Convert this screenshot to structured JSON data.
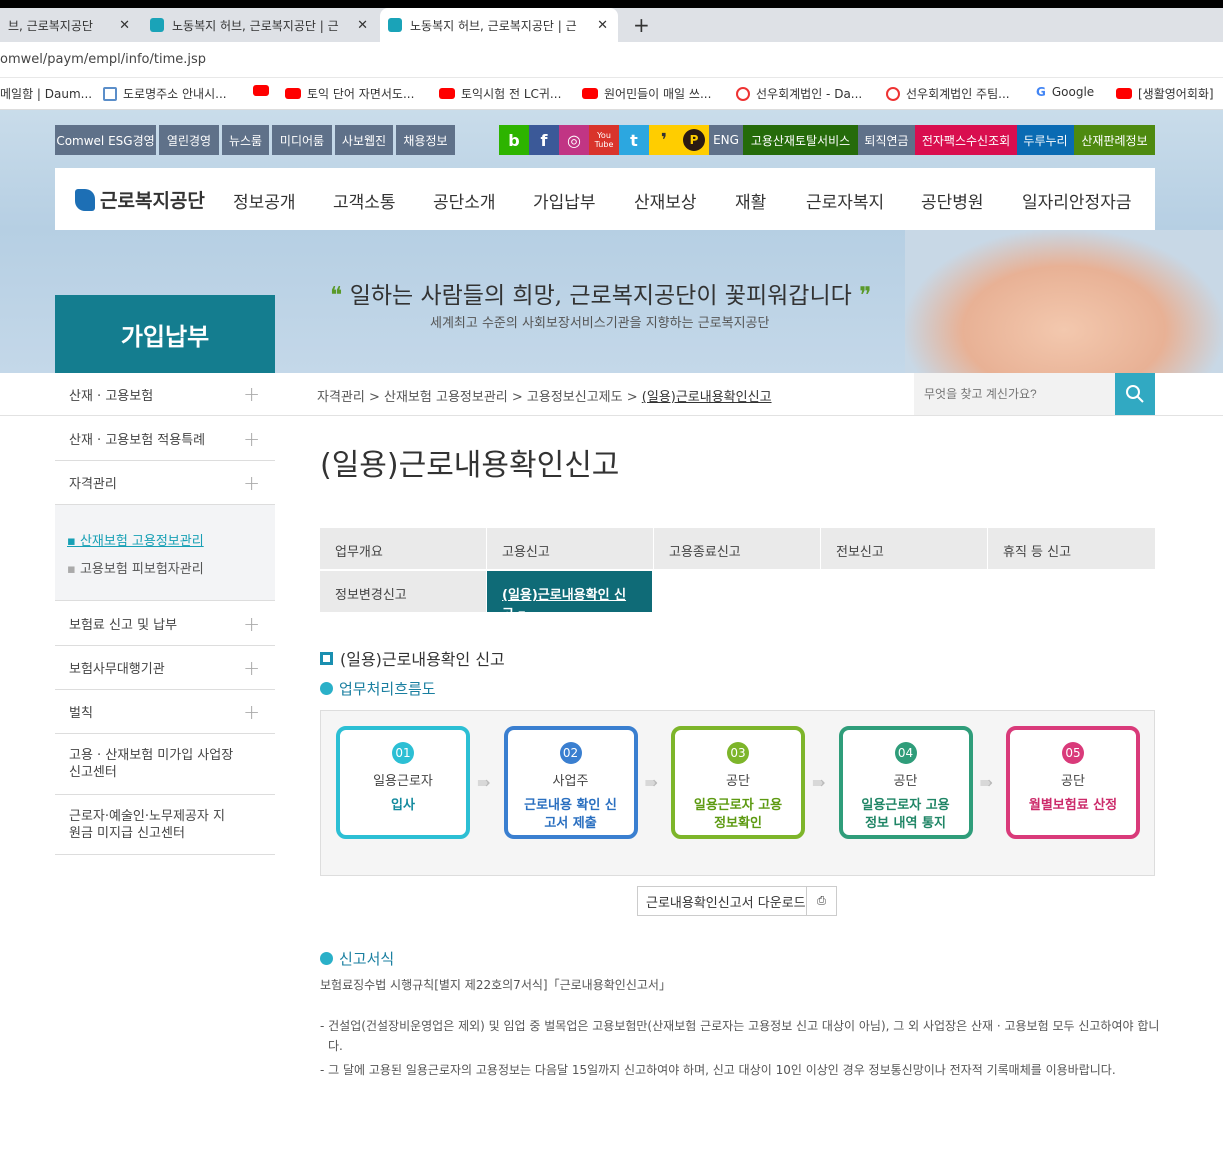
{
  "browser": {
    "tabs": [
      {
        "title": "브, 근로복지공단"
      },
      {
        "title": "노동복지 허브, 근로복지공단 | 근"
      },
      {
        "title": "노동복지 허브, 근로복지공단 | 근"
      }
    ],
    "close": "✕",
    "new_tab": "+",
    "url": "omwel/paym/empl/info/time.jsp",
    "bookmarks": [
      "메일함 | Daum...",
      "도로명주소 안내시...",
      "",
      "토익 단어 자면서도...",
      "토익시험 전 LC귀...",
      "원어민들이 매일 쓰...",
      "선우회계법인 - Da...",
      "선우회계법인 주팀...",
      "Google",
      "[생활영어회화]"
    ]
  },
  "util_left": [
    "Comwel ESG경영",
    "열린경영",
    "뉴스룸",
    "미디어룸",
    "사보웹진",
    "채용정보"
  ],
  "social": [
    "b",
    "f",
    "◎",
    "You Tube",
    "t",
    "❜",
    "P"
  ],
  "util_right": [
    "ENG",
    "고용산재토탈서비스",
    "퇴직연금",
    "전자팩스수신조회",
    "두루누리",
    "산재판례정보"
  ],
  "colors": {
    "accent": "#147d8f",
    "search": "#31a9c2"
  },
  "logo": "근로복지공단",
  "gnb": [
    "정보공개",
    "고객소통",
    "공단소개",
    "가입납부",
    "산재보상",
    "재활",
    "근로자복지",
    "공단병원",
    "일자리안정자금"
  ],
  "slogan": "일하는 사람들의 희망, 근로복지공단이 꽃피워갑니다",
  "slogan_sub": "세계최고 수준의 사회보장서비스기관을 지향하는 근로복지공단",
  "lnb_title": "가입납부",
  "side": [
    "산재 · 고용보험",
    "산재 · 고용보험 적용특례",
    "자격관리",
    "보험료 신고 및 납부",
    "보험사무대행기관",
    "벌칙",
    "고용 · 산재보험 미가입 사업장 신고센터",
    "근로자·예술인·노무제공자 지원금 미지급 신고센터"
  ],
  "side_sub": [
    "산재보험 고용정보관리",
    "고용보험 피보험자관리"
  ],
  "breadcrumb": [
    "자격관리",
    "산재보험 고용정보관리",
    "고용정보신고제도",
    "(일용)근로내용확인신고"
  ],
  "search_placeholder": "무엇을 찾고 계신가요?",
  "page_title": "(일용)근로내용확인신고",
  "subtabs": [
    "업무개요",
    "고용신고",
    "고용종료신고",
    "전보신고",
    "휴직 등 신고",
    "정보변경신고",
    "(일용)근로내용확인 신고"
  ],
  "section_title": "(일용)근로내용확인 신고",
  "flow_title": "업무처리흐름도",
  "steps": [
    {
      "num": "01",
      "who": "일용근로자",
      "act": "입사",
      "color": "#2cbfd4",
      "text": "#138a9e"
    },
    {
      "num": "02",
      "who": "사업주",
      "act": "근로내용 확인 신고서 제출",
      "color": "#3a7fd0",
      "text": "#2a6fc0"
    },
    {
      "num": "03",
      "who": "공단",
      "act": "일용근로자 고용정보확인",
      "color": "#7db52a",
      "text": "#5d9a12"
    },
    {
      "num": "04",
      "who": "공단",
      "act": "일용근로자 고용정보 내역 통지",
      "color": "#2f9d7a",
      "text": "#1f8565"
    },
    {
      "num": "05",
      "who": "공단",
      "act": "월별보험료 산정",
      "color": "#d93a7a",
      "text": "#cc2a6a"
    }
  ],
  "download": "근로내용확인신고서 다운로드",
  "form_title": "신고서식",
  "form_text": "보험료징수법 시행규칙[별지 제22호의7서식]「근로내용확인신고서」",
  "notes": [
    "- 건설업(건설장비운영업은 제외) 및 임업 중 벌목업은 고용보험만(산재보험 근로자는 고용정보 신고 대상이 아님), 그 외 사업장은 산재 · 고용보험 모두 신고하여야 합니다.",
    "- 그 달에 고용된 일용근로자의 고용정보는 다음달 15일까지 신고하여야 하며, 신고 대상이 10인 이상인 경우 정보통신망이나 전자적 기록매체를 이용바랍니다."
  ]
}
